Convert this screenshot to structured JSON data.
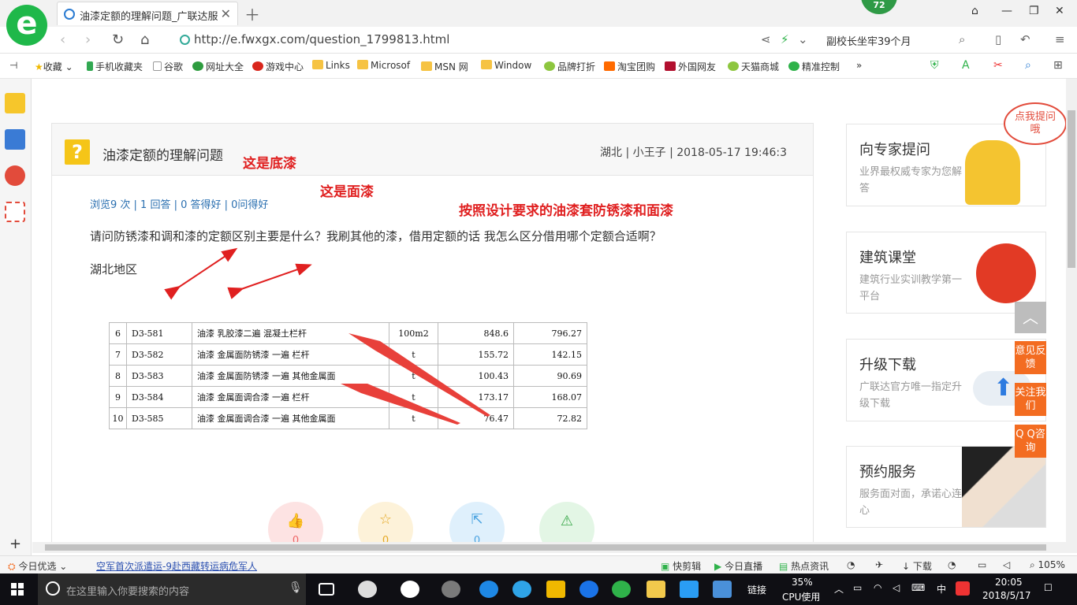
{
  "browser": {
    "tab_title": "油漆定额的理解问题_广联达服务",
    "badge": "72",
    "url": "http://e.fwxgx.com/question_1799813.html",
    "search_hint": "副校长坐牢39个月"
  },
  "bookmarks": [
    "收藏",
    "手机收藏夹",
    "谷歌",
    "网址大全",
    "游戏中心",
    "Links",
    "Microsof",
    "MSN 网",
    "Window",
    "品牌打折",
    "淘宝团购",
    "外国网友",
    "天猫商城",
    "精准控制"
  ],
  "question": {
    "title": "油漆定额的理解问题",
    "meta": "湖北 | 小王子 | 2018-05-17 19:46:3",
    "stats": "浏览9 次 | 1 回答 | 0 答得好 | 0问得好",
    "body": "请问防锈漆和调和漆的定额区别主要是什么？我刷其他的漆，借用定额的话 我怎么区分借用哪个定额合适啊？",
    "region": "湖北地区"
  },
  "table": {
    "rows": [
      [
        "6",
        "D3-581",
        "油漆 乳胶漆二遍 混凝土栏杆",
        "100m2",
        "848.6",
        "796.27"
      ],
      [
        "7",
        "D3-582",
        "油漆 金属面防锈漆 一遍 栏杆",
        "t",
        "155.72",
        "142.15"
      ],
      [
        "8",
        "D3-583",
        "油漆 金属面防锈漆 一遍 其他金属面",
        "t",
        "100.43",
        "90.69"
      ],
      [
        "9",
        "D3-584",
        "油漆 金属面调合漆 一遍 栏杆",
        "t",
        "173.17",
        "168.07"
      ],
      [
        "10",
        "D3-585",
        "油漆 金属面调合漆 一遍 其他金属面",
        "t",
        "76.47",
        "72.82"
      ]
    ]
  },
  "annotations": {
    "primer": "这是底漆",
    "topcoat": "这是面漆",
    "note": "按照设计要求的油漆套防锈漆和面漆"
  },
  "actions": {
    "like": "0",
    "fav": "0",
    "share": "0"
  },
  "sidebar_cards": [
    {
      "title": "向专家提问",
      "sub": "业界最权威专家为您解答",
      "bubble": "点我提问哦"
    },
    {
      "title": "建筑课堂",
      "sub": "建筑行业实训教学第一平台"
    },
    {
      "title": "升级下载",
      "sub": "广联达官方唯一指定升级下载"
    },
    {
      "title": "预约服务",
      "sub": "服务面对面，承诺心连心"
    }
  ],
  "floaters": {
    "feedback": "意见反馈",
    "follow": "关注我们",
    "qq": "Q Q咨询"
  },
  "statusbar": {
    "today": "今日优选",
    "news": "空军首次派遣运-9赴西藏转运病危军人",
    "clip": "快剪辑",
    "live": "今日直播",
    "hot": "热点资讯",
    "download": "下载",
    "zoom": "105%"
  },
  "taskbar": {
    "search_placeholder": "在这里输入你要搜索的内容",
    "link": "链接",
    "cpu_value": "35%",
    "cpu_label": "CPU使用",
    "ime": "中",
    "time": "20:05",
    "date": "2018/5/17"
  },
  "colors": {
    "accent_green": "#1fb84a",
    "annotation_red": "#e02020",
    "link_blue": "#2a6fb0",
    "orange": "#f36c21"
  }
}
